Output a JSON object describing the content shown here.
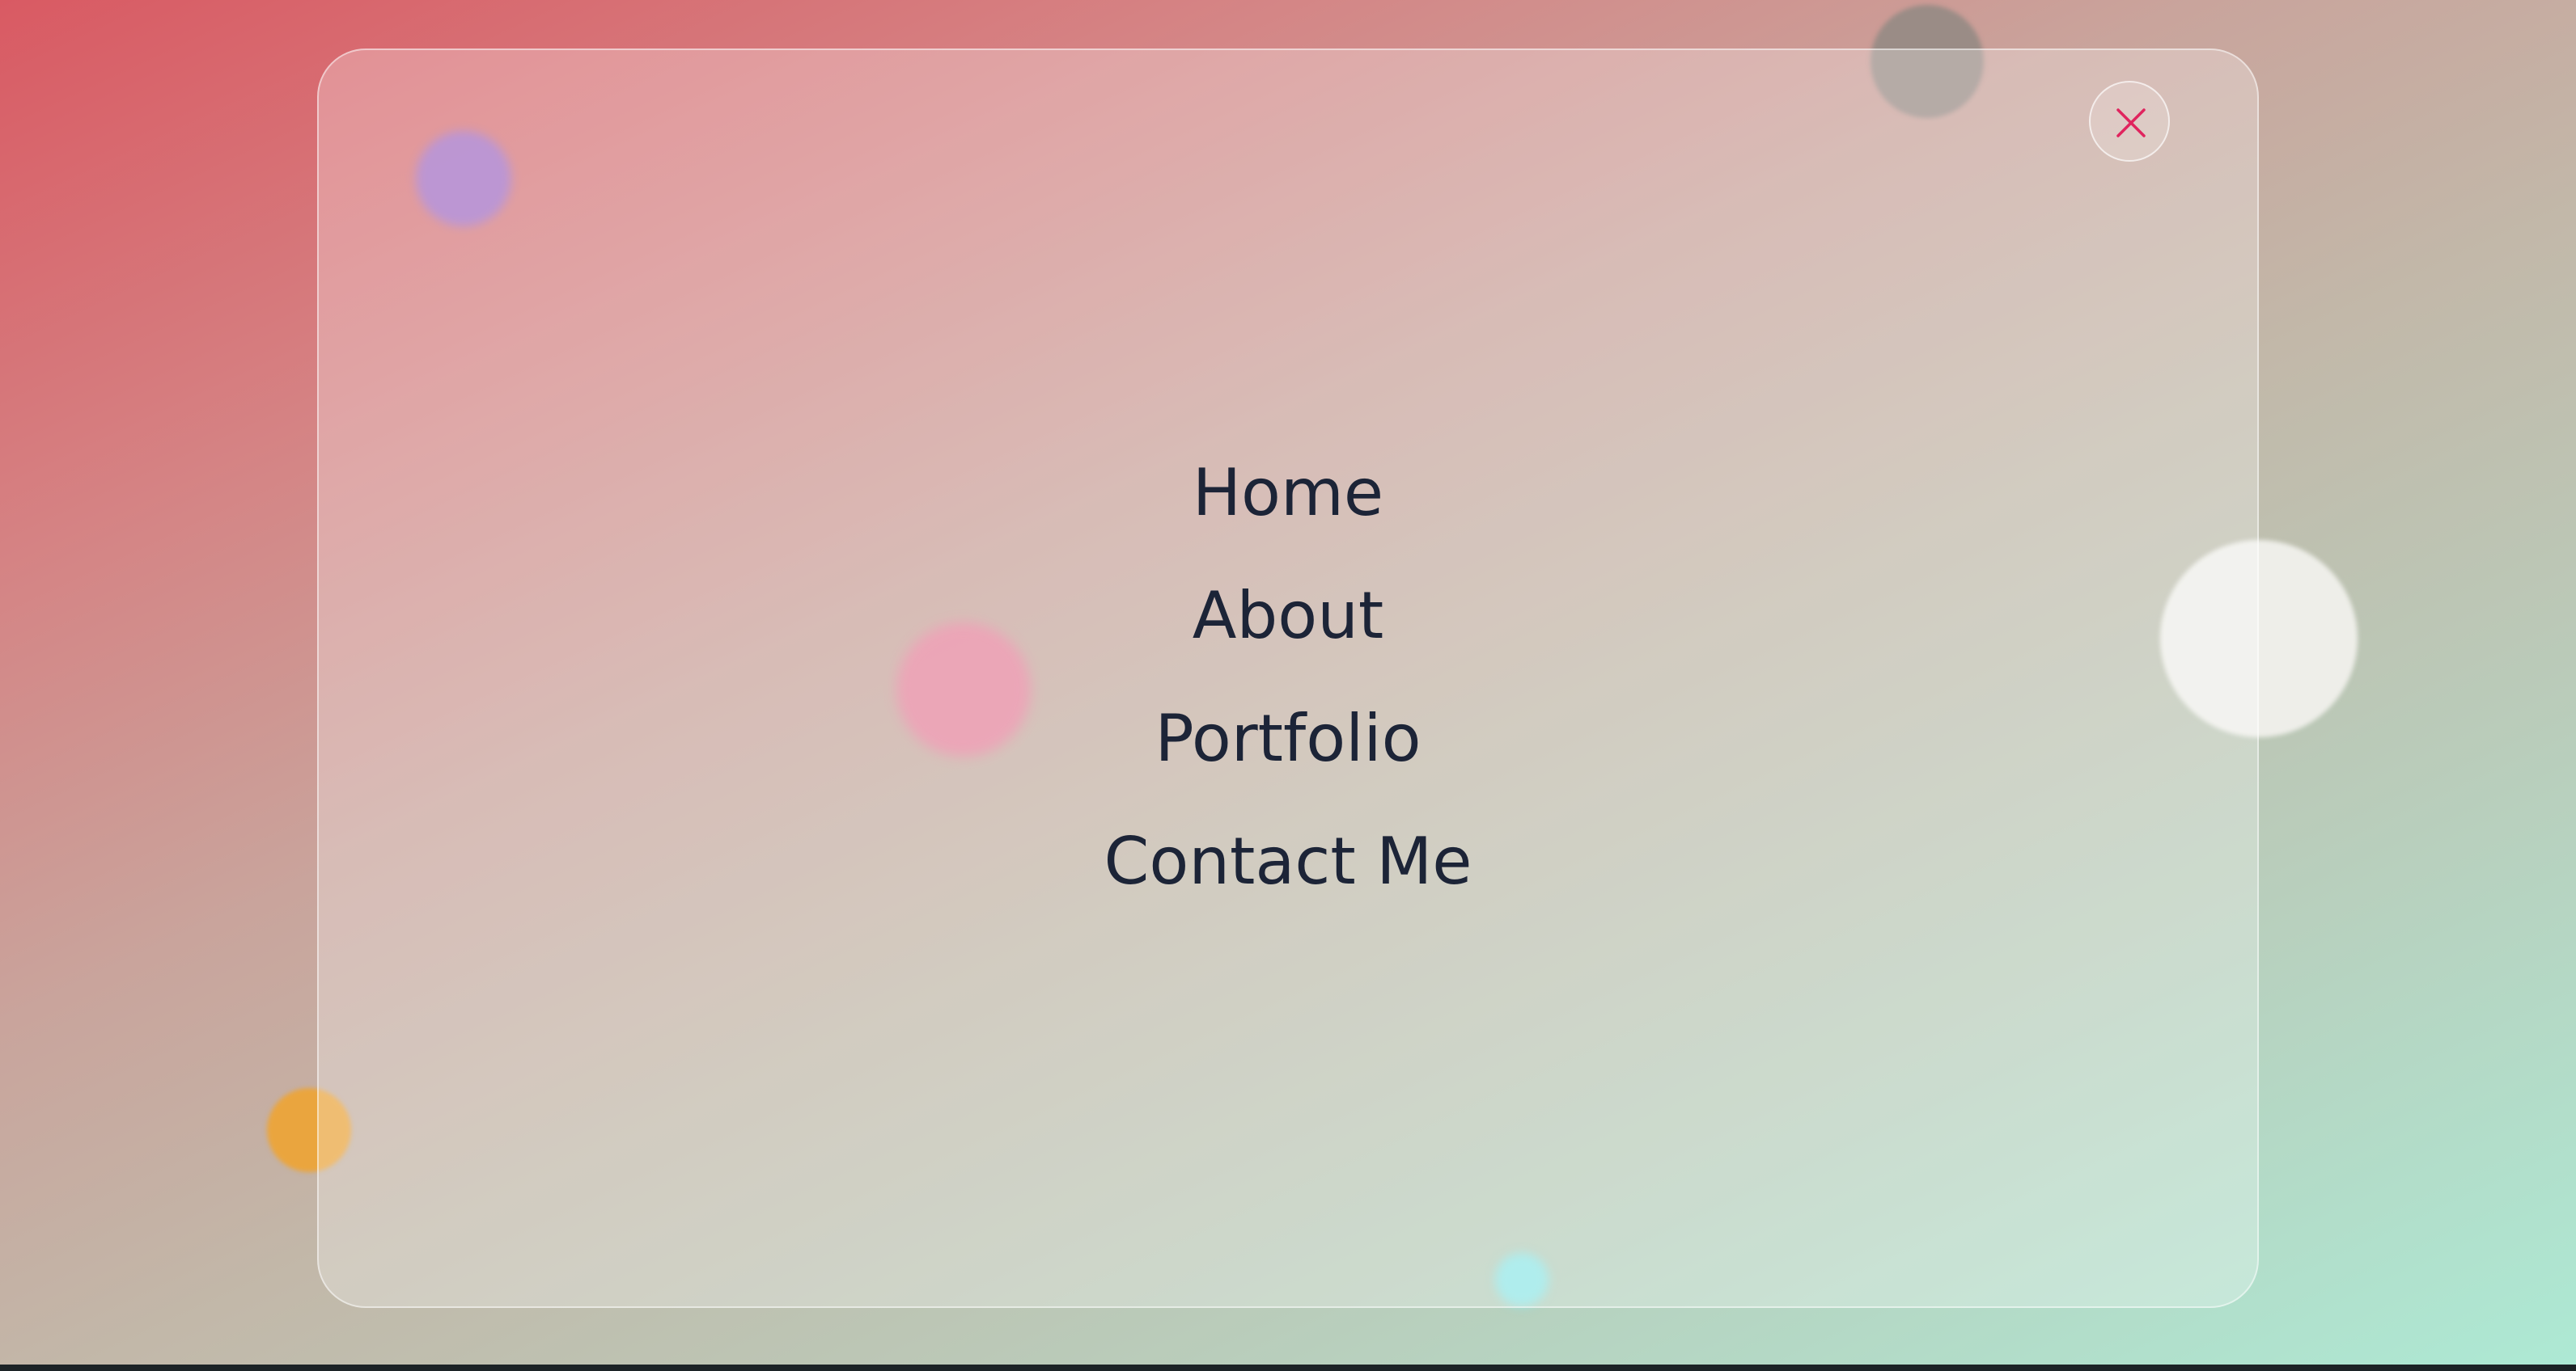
{
  "overlay": {
    "close_icon": "close-icon",
    "accent_color": "#e0245e",
    "text_color": "#1c2437"
  },
  "menu": {
    "items": [
      {
        "label": "Home"
      },
      {
        "label": "About"
      },
      {
        "label": "Portfolio"
      },
      {
        "label": "Contact Me"
      }
    ]
  }
}
